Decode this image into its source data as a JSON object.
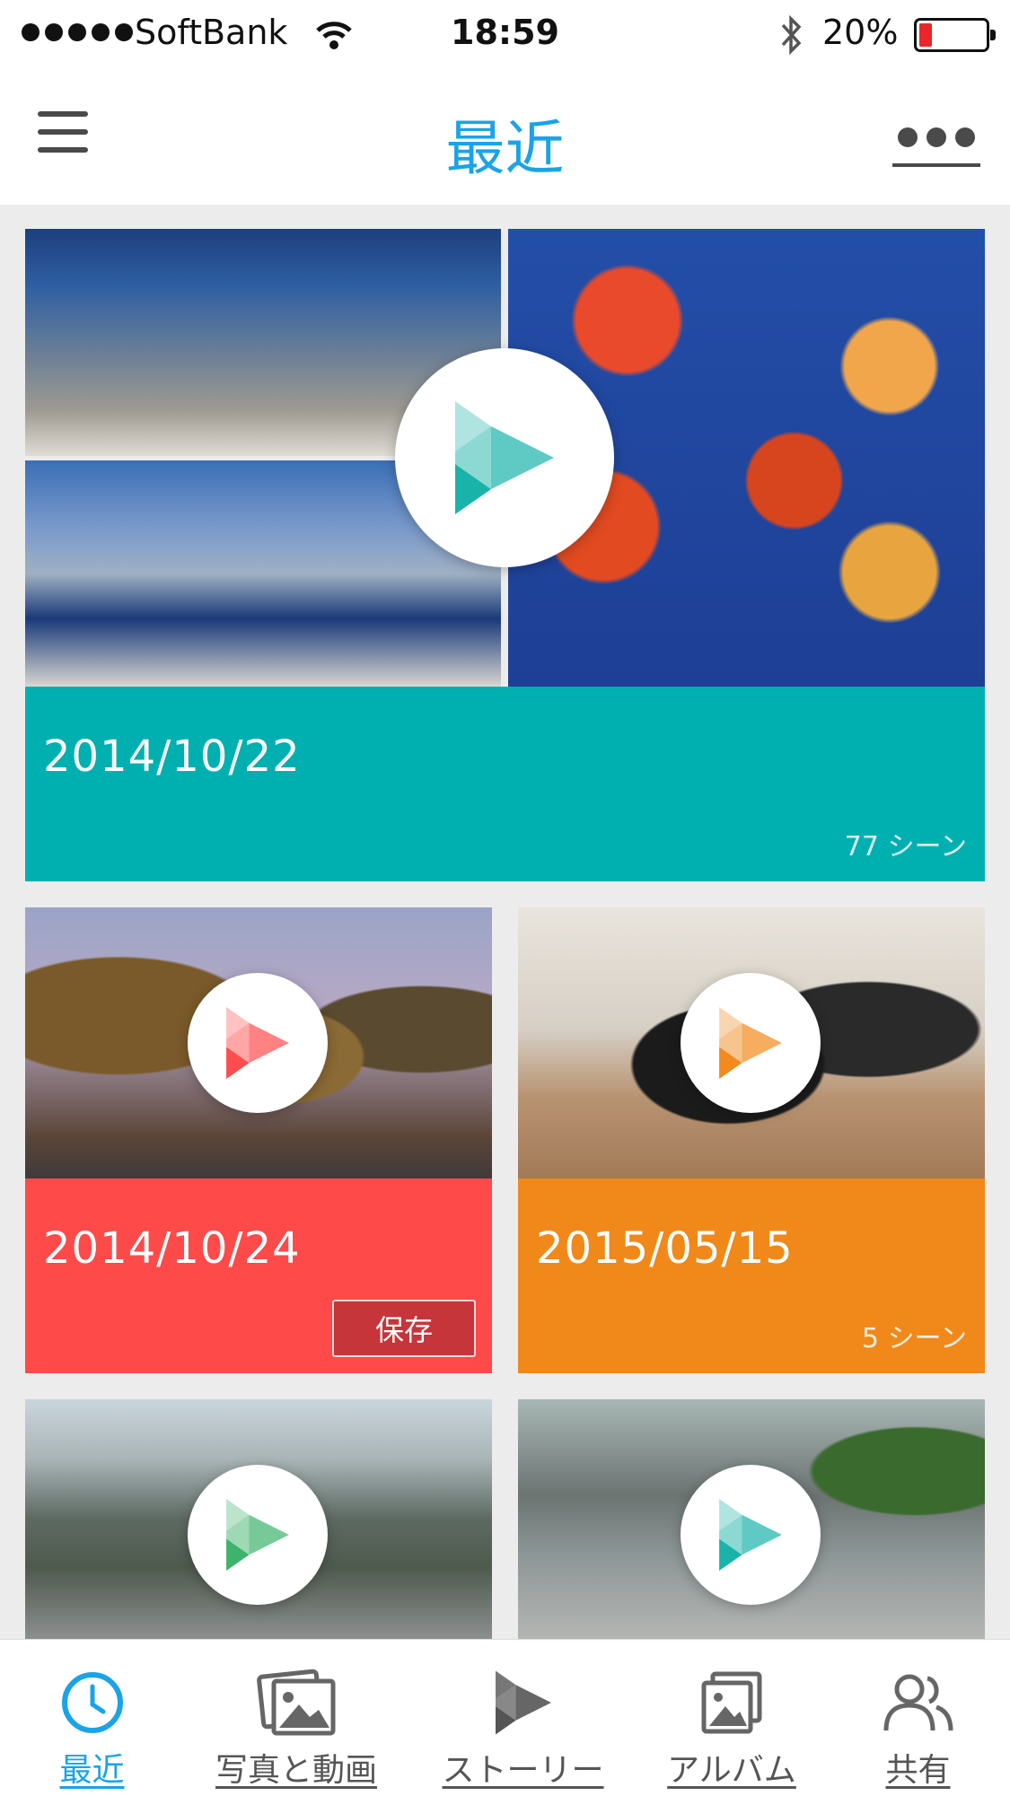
{
  "status_bar": {
    "carrier": "SoftBank",
    "time": "18:59",
    "battery": "20%"
  },
  "nav": {
    "title": "最近"
  },
  "cards": [
    {
      "date": "2014/10/22",
      "scenes": "77 シーン",
      "color": "#00b0b0",
      "icon_color": "#1ab3aa"
    },
    {
      "date": "2014/10/24",
      "save_label": "保存",
      "color": "#ff4a4a",
      "icon_color": "#ff4d4d"
    },
    {
      "date": "2015/05/15",
      "scenes": "5 シーン",
      "color": "#f0891a",
      "icon_color": "#f28a1d"
    },
    {
      "icon_color": "#3db36b"
    },
    {
      "icon_color": "#1ab3aa"
    }
  ],
  "tabs": [
    {
      "label": "最近",
      "icon": "clock-icon",
      "active": true
    },
    {
      "label": "写真と動画",
      "icon": "photos-icon"
    },
    {
      "label": "ストーリー",
      "icon": "story-icon"
    },
    {
      "label": "アルバム",
      "icon": "album-icon"
    },
    {
      "label": "共有",
      "icon": "share-people-icon"
    }
  ]
}
